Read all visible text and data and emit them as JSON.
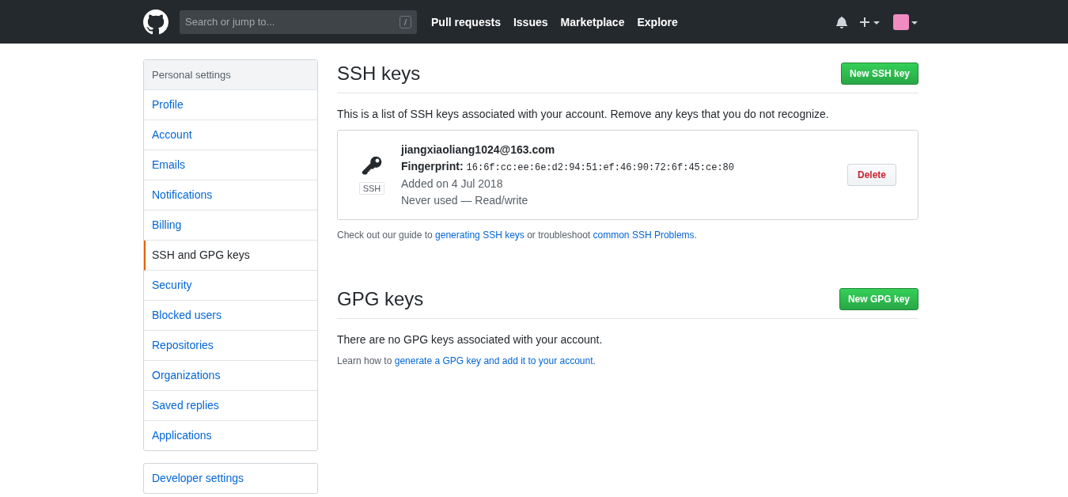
{
  "header": {
    "search": {
      "placeholder": "Search or jump to...",
      "shortcut": "/"
    },
    "nav": [
      "Pull requests",
      "Issues",
      "Marketplace",
      "Explore"
    ]
  },
  "sidebar": {
    "title": "Personal settings",
    "items": [
      {
        "label": "Profile",
        "selected": false
      },
      {
        "label": "Account",
        "selected": false
      },
      {
        "label": "Emails",
        "selected": false
      },
      {
        "label": "Notifications",
        "selected": false
      },
      {
        "label": "Billing",
        "selected": false
      },
      {
        "label": "SSH and GPG keys",
        "selected": true
      },
      {
        "label": "Security",
        "selected": false
      },
      {
        "label": "Blocked users",
        "selected": false
      },
      {
        "label": "Repositories",
        "selected": false
      },
      {
        "label": "Organizations",
        "selected": false
      },
      {
        "label": "Saved replies",
        "selected": false
      },
      {
        "label": "Applications",
        "selected": false
      }
    ],
    "developer": "Developer settings"
  },
  "ssh": {
    "title": "SSH keys",
    "button": "New SSH key",
    "intro": "This is a list of SSH keys associated with your account. Remove any keys that you do not recognize.",
    "keys": [
      {
        "badge": "SSH",
        "name": "jiangxiaoliang1024@163.com",
        "fingerprint_label": "Fingerprint:",
        "fingerprint": "16:6f:cc:ee:6e:d2:94:51:ef:46:90:72:6f:45:ce:80",
        "added": "Added on 4 Jul 2018",
        "usage": "Never used — Read/write",
        "delete": "Delete"
      }
    ],
    "guide": [
      {
        "kind": "text",
        "text": "Check out our guide to "
      },
      {
        "kind": "link",
        "text": "generating SSH keys"
      },
      {
        "kind": "text",
        "text": " or troubleshoot "
      },
      {
        "kind": "link",
        "text": "common SSH Problems"
      },
      {
        "kind": "text",
        "text": "."
      }
    ]
  },
  "gpg": {
    "title": "GPG keys",
    "button": "New GPG key",
    "empty": "There are no GPG keys associated with your account.",
    "guide": [
      {
        "kind": "text",
        "text": "Learn how to "
      },
      {
        "kind": "link",
        "text": "generate a GPG key and add it to your account"
      },
      {
        "kind": "text",
        "text": "."
      }
    ]
  }
}
